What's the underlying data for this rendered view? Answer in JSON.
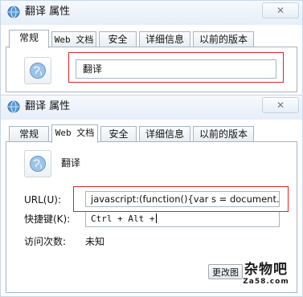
{
  "top_dialog": {
    "title": "翻译 属性",
    "close_label": "✕",
    "tabs": [
      "常规",
      "Web 文档",
      "安全",
      "详细信息",
      "以前的版本"
    ],
    "active_tab": 0,
    "name_value": "翻译"
  },
  "bottom_dialog": {
    "title": "翻译 属性",
    "close_label": "✕",
    "tabs": [
      "常规",
      "Web 文档",
      "安全",
      "详细信息",
      "以前的版本"
    ],
    "active_tab": 1,
    "name_value": "翻译",
    "url_label": "URL(U):",
    "url_value": "javascript:(function(){var s = document.create",
    "shortcut_label": "快捷键(K):",
    "shortcut_value": "Ctrl + Alt +",
    "visits_label": "访问次数:",
    "visits_value": "未知",
    "change_icon_label": "更改图"
  },
  "watermark": {
    "main": "杂物吧",
    "sub": "Za58.com"
  },
  "colors": {
    "highlight": "#d8262a",
    "titlebar": "#e6eef8"
  },
  "icons": [
    "globe-icon",
    "close-icon"
  ]
}
